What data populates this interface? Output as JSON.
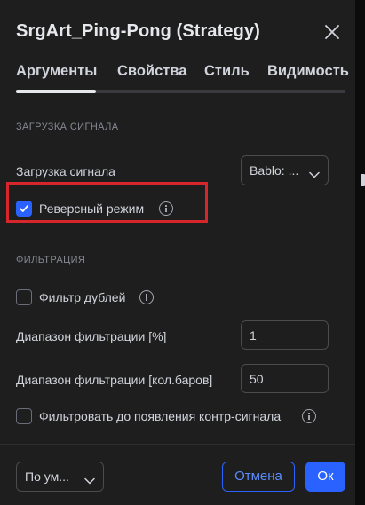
{
  "dialog": {
    "title": "SrgArt_Ping-Pong (Strategy)",
    "close_icon": "close-icon"
  },
  "tabs": [
    {
      "label": "Аргументы",
      "active": true
    },
    {
      "label": "Свойства",
      "active": false
    },
    {
      "label": "Стиль",
      "active": false
    },
    {
      "label": "Видимость",
      "active": false
    }
  ],
  "signal_section": {
    "title": "ЗАГРУЗКА СИГНАЛА",
    "load_label": "Загрузка сигнала",
    "load_value": "Bablo: ...",
    "reverse_label": "Реверсный режим",
    "reverse_checked": true
  },
  "filter_section": {
    "title": "ФИЛЬТРАЦИЯ",
    "dup_filter_label": "Фильтр дублей",
    "dup_filter_checked": false,
    "range_pct_label": "Диапазон фильтрации [%]",
    "range_pct_value": "1",
    "range_bars_label": "Диапазон фильтрации [кол.баров]",
    "range_bars_value": "50",
    "counter_signal_label": "Фильтровать до появления контр-сигнала",
    "counter_signal_checked": false
  },
  "footer": {
    "defaults_value": "По ум...",
    "cancel_label": "Отмена",
    "ok_label": "Ок"
  },
  "colors": {
    "accent": "#2962ff",
    "highlight": "#d7262b",
    "background": "#1e1e1e"
  }
}
